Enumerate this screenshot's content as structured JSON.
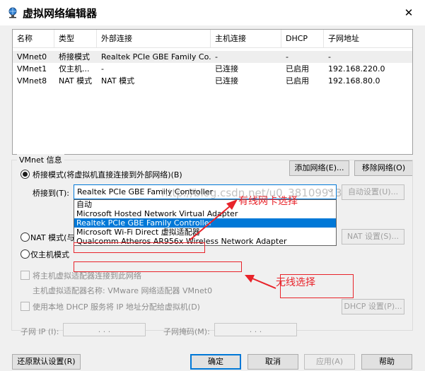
{
  "window": {
    "title": "虚拟网络编辑器",
    "close": "✕"
  },
  "table": {
    "columns": [
      "名称",
      "类型",
      "外部连接",
      "主机连接",
      "DHCP",
      "子网地址"
    ],
    "rows": [
      [
        "VMnet0",
        "桥接模式",
        "Realtek PCIe GBE Family Co...",
        "-",
        "-",
        "-"
      ],
      [
        "VMnet1",
        "仅主机...",
        "-",
        "已连接",
        "已启用",
        "192.168.220.0"
      ],
      [
        "VMnet8",
        "NAT 模式",
        "NAT 模式",
        "已连接",
        "已启用",
        "192.168.80.0"
      ]
    ]
  },
  "buttons": {
    "add_network": "添加网络(E)...",
    "remove_network": "移除网络(O)",
    "auto_settings": "自动设置(U)...",
    "nat_settings": "NAT 设置(S)...",
    "dhcp_settings": "DHCP 设置(P)...",
    "restore_defaults": "还原默认设置(R)",
    "ok": "确定",
    "cancel": "取消",
    "apply": "应用(A)",
    "help": "帮助"
  },
  "vmnet_info": {
    "group_title": "VMnet 信息",
    "bridged_label": "桥接模式(将虚拟机直接连接到外部网络)(B)",
    "bridged_to_label": "桥接到(T):",
    "bridged_to_value": "Realtek PCIe GBE Family Controller",
    "nat_label": "NAT 模式(与",
    "hostonly_label": "仅主机模式",
    "connect_host_label": "将主机虚拟适配器连接到此网络",
    "host_adapter_name": "主机虚拟适配器名称: VMware 网络适配器 VMnet0",
    "dhcp_label": "使用本地 DHCP 服务将 IP 地址分配给虚拟机(D)",
    "subnet_ip_label": "子网 IP (I):",
    "subnet_mask_label": "子网掩码(M):",
    "subnet_ip_value": ". . .",
    "subnet_mask_value": ". . ."
  },
  "dropdown": {
    "options": [
      "自动",
      "Microsoft Hosted Network Virtual Adapter",
      "Realtek PCIe GBE Family Controller",
      "Microsoft Wi-Fi Direct 虚拟适配器",
      "Qualcomm Atheros AR956x Wireless Network Adapter"
    ],
    "highlighted_index": 2
  },
  "annotations": {
    "wired": "有线网卡选择",
    "wireless": "无线选择",
    "watermark": "http://blog.csdn.net/u0_38109913"
  },
  "colors": {
    "annotation_red": "#e8232a",
    "selection_blue": "#0078d7"
  }
}
